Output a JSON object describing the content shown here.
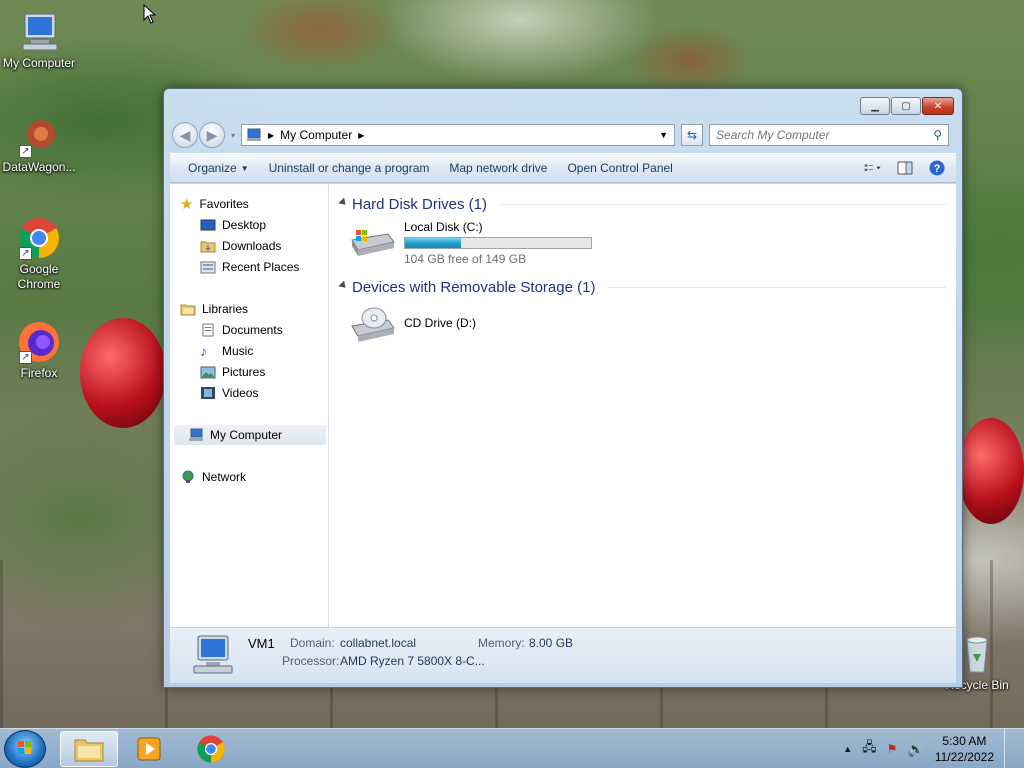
{
  "desktop": {
    "icons": [
      {
        "label": "My Computer"
      },
      {
        "label": "DataWagon..."
      },
      {
        "label": "Google Chrome"
      },
      {
        "label": "Firefox"
      },
      {
        "label": "Recycle Bin"
      }
    ]
  },
  "window": {
    "address": {
      "path": "My Computer"
    },
    "search": {
      "placeholder": "Search My Computer"
    },
    "toolbar": {
      "organize": "Organize",
      "uninstall": "Uninstall or change a program",
      "map_drive": "Map network drive",
      "control_panel": "Open Control Panel"
    },
    "nav": {
      "favorites": "Favorites",
      "desktop": "Desktop",
      "downloads": "Downloads",
      "recent": "Recent Places",
      "libraries": "Libraries",
      "documents": "Documents",
      "music": "Music",
      "pictures": "Pictures",
      "videos": "Videos",
      "computer": "My Computer",
      "network": "Network"
    },
    "groups": {
      "hdd": "Hard Disk Drives (1)",
      "removable": "Devices with Removable Storage (1)"
    },
    "drives": {
      "c": {
        "name": "Local Disk (C:)",
        "free_text": "104 GB free of 149 GB",
        "used_fraction": 0.3
      },
      "d": {
        "name": "CD Drive (D:)"
      }
    },
    "details": {
      "name": "VM1",
      "domain_label": "Domain:",
      "domain": "collabnet.local",
      "memory_label": "Memory:",
      "memory": "8.00 GB",
      "processor_label": "Processor:",
      "processor": "AMD Ryzen 7 5800X 8-C..."
    }
  },
  "taskbar": {
    "time": "5:30 AM",
    "date": "11/22/2022"
  },
  "colors": {
    "accent": "#1e3287",
    "progress": "#1f9cc7"
  }
}
